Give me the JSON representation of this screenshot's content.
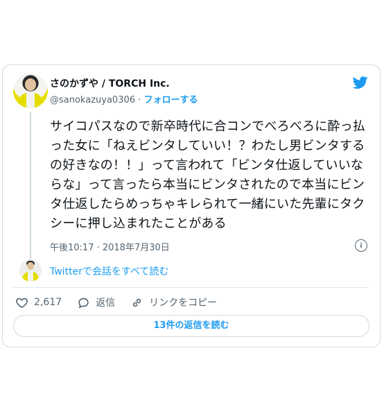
{
  "author": {
    "display_name": "さのかずや / TORCH Inc.",
    "handle": "@sanokazuya0306",
    "separator": "·",
    "follow_label": "フォローする"
  },
  "tweet": {
    "text": "サイコパスなので新卒時代に合コンでべろべろに酔っ払った女に「ねえビンタしていい！？わたし男ビンタするの好きなの！！」って言われて「ビンタ仕返していいならな」って言ったら本当にビンタされたので本当にビンタ仕返したらめっちゃキレられて一緒にいた先輩にタクシーに押し込まれたことがある",
    "timestamp": "午後10:17 · 2018年7月30日",
    "info_glyph": "i"
  },
  "conversation": {
    "read_label": "Twitterで会話をすべて読む"
  },
  "actions": {
    "like_count": "2,617",
    "reply_label": "返信",
    "copy_link_label": "リンクをコピー"
  },
  "replies_button": {
    "label": "13件の返信を読む"
  },
  "colors": {
    "accent": "#1d9bf0",
    "secondary_text": "#536471",
    "border": "#cfd9de"
  },
  "icons": [
    "twitter-bird-icon",
    "info-icon",
    "heart-icon",
    "reply-bubble-icon",
    "link-icon"
  ]
}
